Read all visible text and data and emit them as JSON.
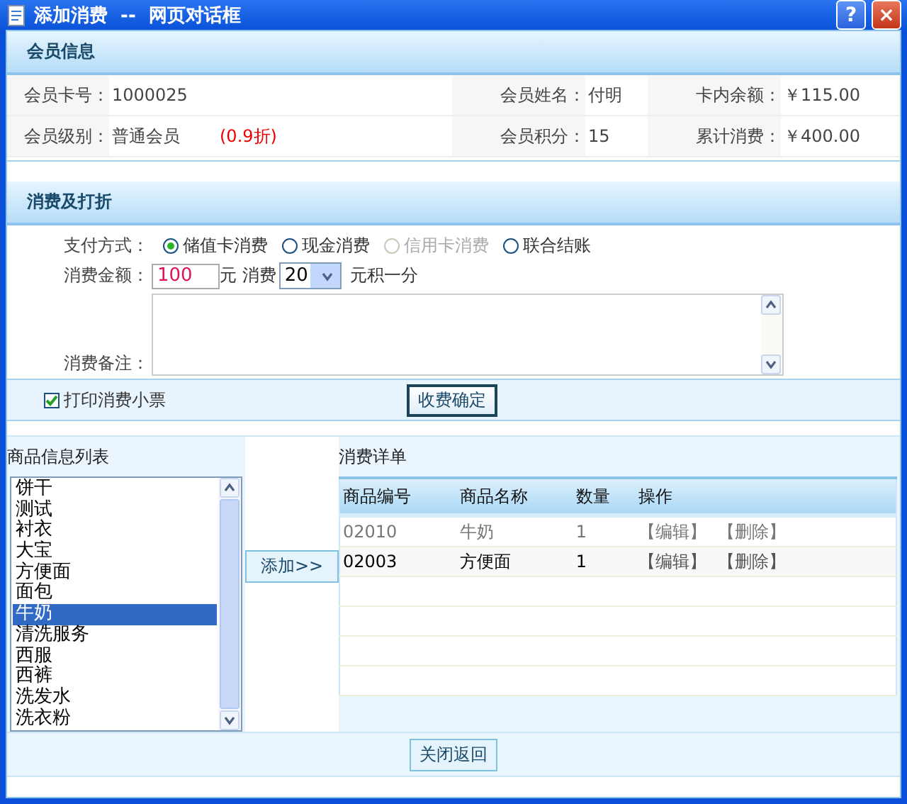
{
  "window": {
    "title": "添加消费  --  网页对话框",
    "help": "?",
    "close": "×"
  },
  "member_section": {
    "title": "会员信息",
    "rows": [
      [
        {
          "label": "会员卡号：",
          "value": "1000025"
        },
        {
          "label": "会员姓名：",
          "value": "付明"
        },
        {
          "label": "卡内余额：",
          "value": "￥115.00"
        }
      ],
      [
        {
          "label": "会员级别：",
          "value": "普通会员",
          "note": "(0.9折)"
        },
        {
          "label": "会员积分：",
          "value": "15"
        },
        {
          "label": "累计消费：",
          "value": "￥400.00"
        }
      ]
    ]
  },
  "consume_section": {
    "title": "消费及打折",
    "payment_label": "支付方式：",
    "payment_options": [
      {
        "label": "储值卡消费",
        "selected": true,
        "disabled": false
      },
      {
        "label": "现金消费",
        "selected": false,
        "disabled": false
      },
      {
        "label": "信用卡消费",
        "selected": false,
        "disabled": true
      },
      {
        "label": "联合结账",
        "selected": false,
        "disabled": false
      }
    ],
    "amount_label": "消费金额：",
    "amount": "100",
    "unit": "元",
    "per_label": "消费",
    "per_value": "20",
    "per_suffix": "元积一分",
    "remark_label": "消费备注：",
    "print_receipt": {
      "label": "打印消费小票",
      "checked": true
    },
    "confirm_button": "收费确定"
  },
  "product_list": {
    "title": "商品信息列表",
    "items": [
      {
        "label": "饼干",
        "selected": false
      },
      {
        "label": "测试",
        "selected": false
      },
      {
        "label": "衬衣",
        "selected": false
      },
      {
        "label": "大宝",
        "selected": false
      },
      {
        "label": "方便面",
        "selected": false
      },
      {
        "label": "面包",
        "selected": false
      },
      {
        "label": "牛奶",
        "selected": true
      },
      {
        "label": "清洗服务",
        "selected": false
      },
      {
        "label": "西服",
        "selected": false
      },
      {
        "label": "西裤",
        "selected": false
      },
      {
        "label": "洗发水",
        "selected": false
      },
      {
        "label": "洗衣粉",
        "selected": false
      }
    ]
  },
  "add_button": "添加>>",
  "detail": {
    "title": "消费详单",
    "columns": [
      "商品编号",
      "商品名称",
      "数量",
      "操作"
    ],
    "rows": [
      {
        "code": "02010",
        "name": "牛奶",
        "qty": "1",
        "edit": "【编辑】",
        "delete": "【删除】",
        "muted": true
      },
      {
        "code": "02003",
        "name": "方便面",
        "qty": "1",
        "edit": "【编辑】",
        "delete": "【删除】",
        "muted": false
      }
    ]
  },
  "close_button": "关闭返回"
}
